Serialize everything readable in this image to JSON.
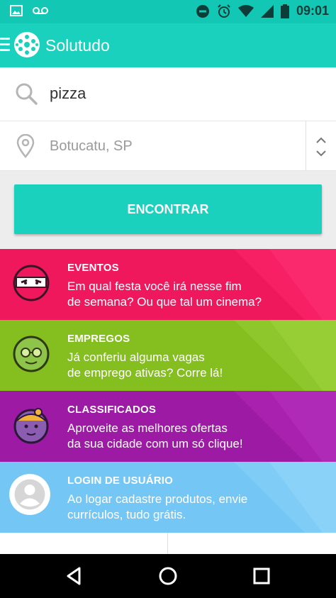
{
  "statusbar": {
    "time": "09:01",
    "left_icons": [
      "image-icon",
      "voicemail-icon"
    ],
    "right_icons": [
      "do-not-disturb-icon",
      "alarm-icon",
      "wifi-icon",
      "signal-icon",
      "battery-icon"
    ]
  },
  "appbar": {
    "title": "Solutudo"
  },
  "search": {
    "query": "pizza"
  },
  "location": {
    "city": "Botucatu, SP"
  },
  "action": {
    "find_label": "ENCONTRAR"
  },
  "cards": [
    {
      "title": "EVENTOS",
      "line1": "Em qual festa você irá nesse fim",
      "line2": "de semana? Ou que tal um cinema?",
      "color": "#f0185c"
    },
    {
      "title": "EMPREGOS",
      "line1": "Já conferiu alguma vagas",
      "line2": "de emprego ativas? Corre lá!",
      "color": "#84be1f"
    },
    {
      "title": "CLASSIFICADOS",
      "line1": "Aproveite as melhores ofertas",
      "line2": "da sua cidade com um só clique!",
      "color": "#9d1aa5"
    },
    {
      "title": "LOGIN DE USUÁRIO",
      "line1": "Ao logar cadastre produtos, envie",
      "line2": "currículos, tudo grátis.",
      "color": "#74c6f5"
    }
  ],
  "bottom": {
    "left_cut": "...",
    "right_cut": "..."
  },
  "navbar": {
    "icons": [
      "back-icon",
      "home-icon",
      "recents-icon"
    ]
  },
  "colors": {
    "accent": "#19d1bd",
    "status": "#12c7b4"
  }
}
